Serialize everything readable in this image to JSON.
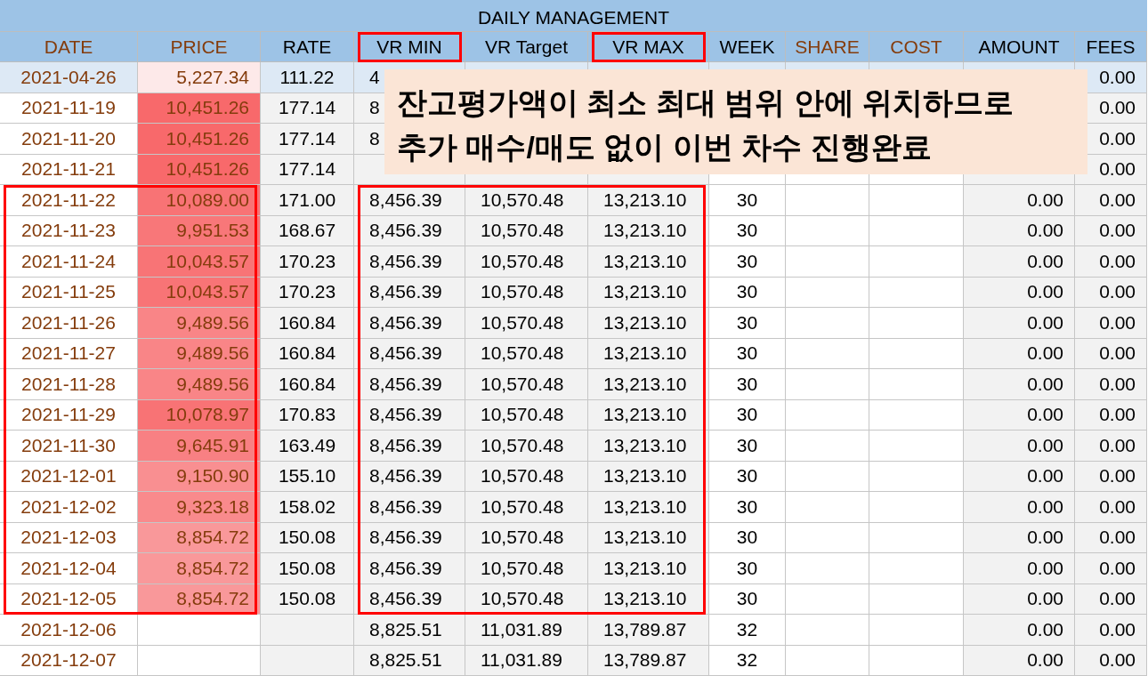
{
  "title": "DAILY MANAGEMENT",
  "columns": [
    {
      "label": "DATE",
      "accent": true,
      "highlighted": false
    },
    {
      "label": "PRICE",
      "accent": true,
      "highlighted": false
    },
    {
      "label": "RATE",
      "accent": false,
      "highlighted": false
    },
    {
      "label": "VR MIN",
      "accent": false,
      "highlighted": true
    },
    {
      "label": "VR Target",
      "accent": false,
      "highlighted": false
    },
    {
      "label": "VR MAX",
      "accent": false,
      "highlighted": true
    },
    {
      "label": "WEEK",
      "accent": false,
      "highlighted": false
    },
    {
      "label": "SHARE",
      "accent": true,
      "highlighted": false
    },
    {
      "label": "COST",
      "accent": true,
      "highlighted": false
    },
    {
      "label": "AMOUNT",
      "accent": false,
      "highlighted": false
    },
    {
      "label": "FEES",
      "accent": false,
      "highlighted": false
    }
  ],
  "rows": [
    {
      "current": true,
      "boxed": false,
      "color": "#fde9e9",
      "cells": [
        "2021-04-26",
        "5,227.34",
        "111.22",
        "4",
        null,
        null,
        null,
        null,
        null,
        null,
        "0.00"
      ]
    },
    {
      "current": false,
      "boxed": false,
      "color": "#f8696b",
      "cells": [
        "2021-11-19",
        "10,451.26",
        "177.14",
        "8",
        null,
        null,
        null,
        null,
        null,
        null,
        "0.00"
      ]
    },
    {
      "current": false,
      "boxed": false,
      "color": "#f8696b",
      "cells": [
        "2021-11-20",
        "10,451.26",
        "177.14",
        "8",
        null,
        null,
        null,
        null,
        null,
        null,
        "0.00"
      ]
    },
    {
      "current": false,
      "boxed": false,
      "color": "#f8696b",
      "cells": [
        "2021-11-21",
        "10,451.26",
        "177.14",
        null,
        null,
        null,
        null,
        null,
        null,
        null,
        "0.00"
      ]
    },
    {
      "current": false,
      "boxed": true,
      "color": "#f87375",
      "cells": [
        "2021-11-22",
        "10,089.00",
        "171.00",
        "8,456.39",
        "10,570.48",
        "13,213.10",
        "30",
        null,
        null,
        "0.00",
        "0.00"
      ]
    },
    {
      "current": false,
      "boxed": true,
      "color": "#f87779",
      "cells": [
        "2021-11-23",
        "9,951.53",
        "168.67",
        "8,456.39",
        "10,570.48",
        "13,213.10",
        "30",
        null,
        null,
        "0.00",
        "0.00"
      ]
    },
    {
      "current": false,
      "boxed": true,
      "color": "#f87476",
      "cells": [
        "2021-11-24",
        "10,043.57",
        "170.23",
        "8,456.39",
        "10,570.48",
        "13,213.10",
        "30",
        null,
        null,
        "0.00",
        "0.00"
      ]
    },
    {
      "current": false,
      "boxed": true,
      "color": "#f87476",
      "cells": [
        "2021-11-25",
        "10,043.57",
        "170.23",
        "8,456.39",
        "10,570.48",
        "13,213.10",
        "30",
        null,
        null,
        "0.00",
        "0.00"
      ]
    },
    {
      "current": false,
      "boxed": true,
      "color": "#f98587",
      "cells": [
        "2021-11-26",
        "9,489.56",
        "160.84",
        "8,456.39",
        "10,570.48",
        "13,213.10",
        "30",
        null,
        null,
        "0.00",
        "0.00"
      ]
    },
    {
      "current": false,
      "boxed": true,
      "color": "#f98587",
      "cells": [
        "2021-11-27",
        "9,489.56",
        "160.84",
        "8,456.39",
        "10,570.48",
        "13,213.10",
        "30",
        null,
        null,
        "0.00",
        "0.00"
      ]
    },
    {
      "current": false,
      "boxed": true,
      "color": "#f98587",
      "cells": [
        "2021-11-28",
        "9,489.56",
        "160.84",
        "8,456.39",
        "10,570.48",
        "13,213.10",
        "30",
        null,
        null,
        "0.00",
        "0.00"
      ]
    },
    {
      "current": false,
      "boxed": true,
      "color": "#f87375",
      "cells": [
        "2021-11-29",
        "10,078.97",
        "170.83",
        "8,456.39",
        "10,570.48",
        "13,213.10",
        "30",
        null,
        null,
        "0.00",
        "0.00"
      ]
    },
    {
      "current": false,
      "boxed": true,
      "color": "#f88083",
      "cells": [
        "2021-11-30",
        "9,645.91",
        "163.49",
        "8,456.39",
        "10,570.48",
        "13,213.10",
        "30",
        null,
        null,
        "0.00",
        "0.00"
      ]
    },
    {
      "current": false,
      "boxed": true,
      "color": "#f98f91",
      "cells": [
        "2021-12-01",
        "9,150.90",
        "155.10",
        "8,456.39",
        "10,570.48",
        "13,213.10",
        "30",
        null,
        null,
        "0.00",
        "0.00"
      ]
    },
    {
      "current": false,
      "boxed": true,
      "color": "#f98a8c",
      "cells": [
        "2021-12-02",
        "9,323.18",
        "158.02",
        "8,456.39",
        "10,570.48",
        "13,213.10",
        "30",
        null,
        null,
        "0.00",
        "0.00"
      ]
    },
    {
      "current": false,
      "boxed": true,
      "color": "#f9989a",
      "cells": [
        "2021-12-03",
        "8,854.72",
        "150.08",
        "8,456.39",
        "10,570.48",
        "13,213.10",
        "30",
        null,
        null,
        "0.00",
        "0.00"
      ]
    },
    {
      "current": false,
      "boxed": true,
      "color": "#f9989a",
      "cells": [
        "2021-12-04",
        "8,854.72",
        "150.08",
        "8,456.39",
        "10,570.48",
        "13,213.10",
        "30",
        null,
        null,
        "0.00",
        "0.00"
      ]
    },
    {
      "current": false,
      "boxed": true,
      "color": "#f9989a",
      "cells": [
        "2021-12-05",
        "8,854.72",
        "150.08",
        "8,456.39",
        "10,570.48",
        "13,213.10",
        "30",
        null,
        null,
        "0.00",
        "0.00"
      ]
    },
    {
      "current": false,
      "boxed": false,
      "cells": [
        "2021-12-06",
        null,
        null,
        "8,825.51",
        "11,031.89",
        "13,789.87",
        "32",
        null,
        null,
        "0.00",
        "0.00"
      ]
    },
    {
      "current": false,
      "boxed": false,
      "cells": [
        "2021-12-07",
        null,
        null,
        "8,825.51",
        "11,031.89",
        "13,789.87",
        "32",
        null,
        null,
        "0.00",
        "0.00"
      ]
    }
  ],
  "callout": {
    "lines": [
      "잔고평가액이 최소 최대 범위 안에 위치하므로",
      "추가 매수/매도 없이 이번 차수 진행완료"
    ]
  }
}
